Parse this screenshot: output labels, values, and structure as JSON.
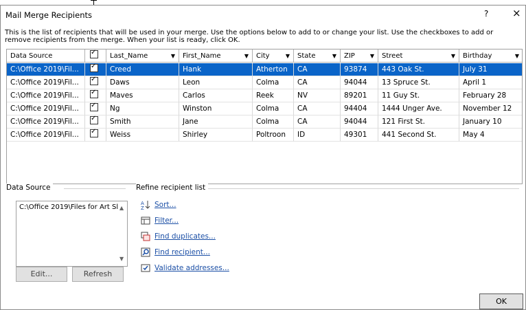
{
  "dialog": {
    "title": "Mail Merge Recipients",
    "help_label": "?",
    "close_label": "×",
    "instructions": "This is the list of recipients that will be used in your merge.  Use the options below to add to or change your list.  Use the checkboxes to add or remove recipients from the merge.  When your list is ready, click OK."
  },
  "grid": {
    "columns": [
      "Data Source",
      "",
      "Last_Name",
      "First_Name",
      "City",
      "State",
      "ZIP",
      "Street",
      "Birthday"
    ],
    "rows": [
      {
        "source": "C:\\Office 2019\\Fil...",
        "checked": true,
        "last": "Creed",
        "first": "Hank",
        "city": "Atherton",
        "state": "CA",
        "zip": "93874",
        "street": "443 Oak St.",
        "birthday": "July 31",
        "selected": true
      },
      {
        "source": "C:\\Office 2019\\Fil...",
        "checked": true,
        "last": "Daws",
        "first": "Leon",
        "city": "Colma",
        "state": "CA",
        "zip": "94044",
        "street": "13 Spruce St.",
        "birthday": "April 1",
        "selected": false
      },
      {
        "source": "C:\\Office 2019\\Fil...",
        "checked": true,
        "last": "Maves",
        "first": "Carlos",
        "city": "Reek",
        "state": "NV",
        "zip": "89201",
        "street": "11 Guy St.",
        "birthday": "February 28",
        "selected": false
      },
      {
        "source": "C:\\Office 2019\\Fil...",
        "checked": true,
        "last": "Ng",
        "first": "Winston",
        "city": "Colma",
        "state": "CA",
        "zip": "94404",
        "street": "1444 Unger Ave.",
        "birthday": "November 12",
        "selected": false
      },
      {
        "source": "C:\\Office 2019\\Fil...",
        "checked": true,
        "last": "Smith",
        "first": "Jane",
        "city": "Colma",
        "state": "CA",
        "zip": "94044",
        "street": "121 First St.",
        "birthday": "January 10",
        "selected": false
      },
      {
        "source": "C:\\Office 2019\\Fil...",
        "checked": true,
        "last": "Weiss",
        "first": "Shirley",
        "city": "Poltroon",
        "state": "ID",
        "zip": "49301",
        "street": "441 Second St.",
        "birthday": "May 4",
        "selected": false
      }
    ]
  },
  "data_source_panel": {
    "label": "Data Source",
    "item": "C:\\Office 2019\\Files for Art Sl",
    "edit_label": "Edit...",
    "refresh_label": "Refresh"
  },
  "refine": {
    "label": "Refine recipient list",
    "items": [
      {
        "label": "Sort...",
        "icon": "sort-az-icon"
      },
      {
        "label": "Filter...",
        "icon": "filter-icon"
      },
      {
        "label": "Find duplicates...",
        "icon": "find-duplicates-icon"
      },
      {
        "label": "Find recipient...",
        "icon": "find-recipient-icon"
      },
      {
        "label": "Validate addresses...",
        "icon": "validate-addresses-icon"
      }
    ]
  },
  "ok_label": "OK",
  "colors": {
    "selection": "#0a64c8",
    "link": "#1a4ea5"
  }
}
